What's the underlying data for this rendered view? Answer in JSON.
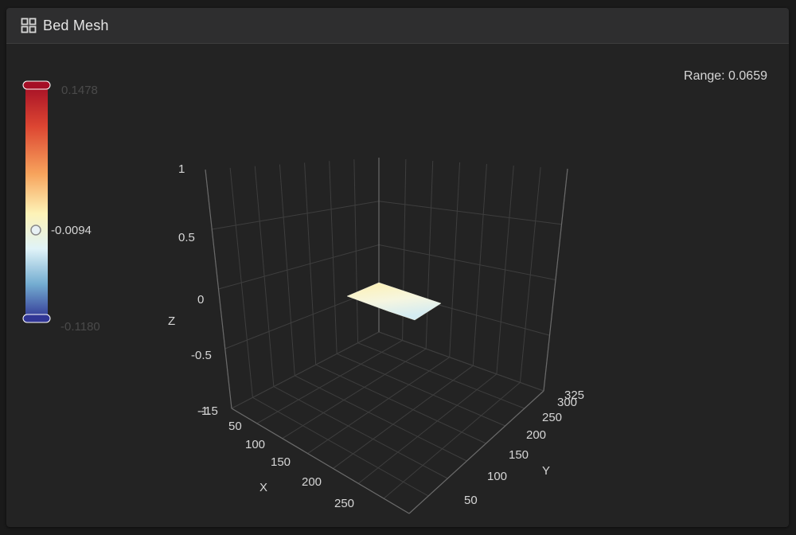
{
  "card": {
    "title": "Bed Mesh",
    "header_icon": "grid-icon"
  },
  "range": {
    "label": "Range: 0.0659"
  },
  "colorbar": {
    "max_label": "0.1478",
    "mid_label": "-0.0094",
    "min_label": "-0.1180",
    "colors": [
      "#a50f26",
      "#dd4632",
      "#f7a35c",
      "#fdf3b7",
      "#e0f3f8",
      "#74add1",
      "#313695"
    ]
  },
  "chart_data": {
    "type": "surface",
    "axes": {
      "x": {
        "label": "X",
        "ticks": [
          "50",
          "100",
          "150",
          "200",
          "250"
        ]
      },
      "y": {
        "label": "Y",
        "ticks": [
          "50",
          "100",
          "150",
          "200",
          "250",
          "300",
          "325"
        ]
      },
      "z": {
        "label": "Z",
        "ticks": [
          "1",
          "0.5",
          "0",
          "-0.5",
          "-1",
          "-1.5"
        ]
      }
    },
    "surface": {
      "z_min": -0.118,
      "z_max": 0.1478,
      "z_mid": -0.0094,
      "range": 0.0659
    },
    "grid": true
  }
}
